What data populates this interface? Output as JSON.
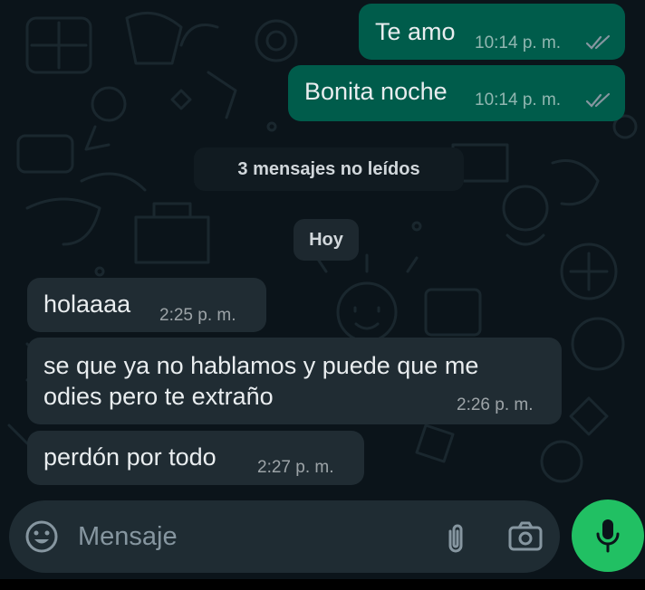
{
  "colors": {
    "background": "#0b141a",
    "outgoing_bubble": "#005c4b",
    "incoming_bubble": "#202c33",
    "pill": "#1d282f",
    "read_ticks": "#8696a0",
    "mic_button": "#21c063"
  },
  "outgoing": [
    {
      "text": "Te amo",
      "time": "10:14 p. m.",
      "status_icon": "double-check-icon"
    },
    {
      "text": "Bonita noche",
      "time": "10:14 p. m.",
      "status_icon": "double-check-icon"
    }
  ],
  "unread_banner": "3 mensajes no leídos",
  "date_pill": "Hoy",
  "incoming": [
    {
      "text": "holaaaa",
      "time": "2:25 p. m."
    },
    {
      "line1": "se que ya no hablamos y puede que me",
      "line2": "odies pero te extraño",
      "time": "2:26 p. m."
    },
    {
      "text": "perdón por todo",
      "time": "2:27 p. m."
    }
  ],
  "composer": {
    "placeholder": "Mensaje",
    "icons": [
      "emoji-icon",
      "attach-icon",
      "camera-icon",
      "mic-icon"
    ]
  }
}
